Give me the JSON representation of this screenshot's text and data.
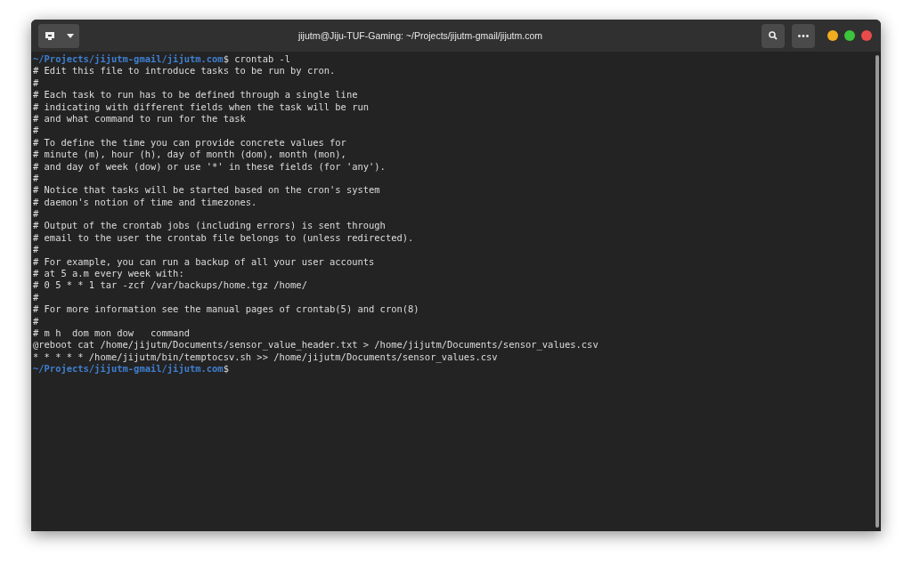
{
  "window": {
    "title": "jijutm@Jiju-TUF-Gaming: ~/Projects/jijutm-gmail/jijutm.com"
  },
  "terminal": {
    "lines": [
      {
        "kind": "prompt",
        "path": "~/Projects/jijutm-gmail/jijutm.com",
        "symbol": "$",
        "command": " crontab -l"
      },
      {
        "kind": "output",
        "text": "# Edit this file to introduce tasks to be run by cron."
      },
      {
        "kind": "output",
        "text": "#"
      },
      {
        "kind": "output",
        "text": "# Each task to run has to be defined through a single line"
      },
      {
        "kind": "output",
        "text": "# indicating with different fields when the task will be run"
      },
      {
        "kind": "output",
        "text": "# and what command to run for the task"
      },
      {
        "kind": "output",
        "text": "#"
      },
      {
        "kind": "output",
        "text": "# To define the time you can provide concrete values for"
      },
      {
        "kind": "output",
        "text": "# minute (m), hour (h), day of month (dom), month (mon),"
      },
      {
        "kind": "output",
        "text": "# and day of week (dow) or use '*' in these fields (for 'any')."
      },
      {
        "kind": "output",
        "text": "#"
      },
      {
        "kind": "output",
        "text": "# Notice that tasks will be started based on the cron's system"
      },
      {
        "kind": "output",
        "text": "# daemon's notion of time and timezones."
      },
      {
        "kind": "output",
        "text": "#"
      },
      {
        "kind": "output",
        "text": "# Output of the crontab jobs (including errors) is sent through"
      },
      {
        "kind": "output",
        "text": "# email to the user the crontab file belongs to (unless redirected)."
      },
      {
        "kind": "output",
        "text": "#"
      },
      {
        "kind": "output",
        "text": "# For example, you can run a backup of all your user accounts"
      },
      {
        "kind": "output",
        "text": "# at 5 a.m every week with:"
      },
      {
        "kind": "output",
        "text": "# 0 5 * * 1 tar -zcf /var/backups/home.tgz /home/"
      },
      {
        "kind": "output",
        "text": "#"
      },
      {
        "kind": "output",
        "text": "# For more information see the manual pages of crontab(5) and cron(8)"
      },
      {
        "kind": "output",
        "text": "#"
      },
      {
        "kind": "output",
        "text": "# m h  dom mon dow   command"
      },
      {
        "kind": "output",
        "text": "@reboot cat /home/jijutm/Documents/sensor_value_header.txt > /home/jijutm/Documents/sensor_values.csv"
      },
      {
        "kind": "output",
        "text": "* * * * * /home/jijutm/bin/temptocsv.sh >> /home/jijutm/Documents/sensor_values.csv"
      },
      {
        "kind": "prompt",
        "path": "~/Projects/jijutm-gmail/jijutm.com",
        "symbol": "$"
      }
    ]
  }
}
